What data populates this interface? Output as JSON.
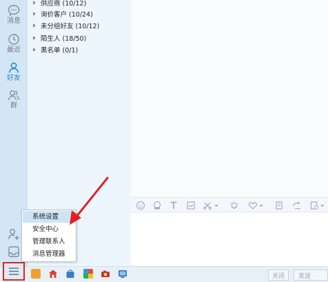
{
  "rail": {
    "items": [
      {
        "label": "消息",
        "icon": "message-icon"
      },
      {
        "label": "最近",
        "icon": "clock-icon"
      },
      {
        "label": "好友",
        "icon": "person-icon"
      },
      {
        "label": "群",
        "icon": "group-icon"
      }
    ],
    "active_index": 2
  },
  "groups": [
    {
      "label": "供应商 (10/12)"
    },
    {
      "label": "询价客户 (10/24)"
    },
    {
      "label": "未分组好友 (10/12)"
    },
    {
      "label": "陌生人 (18/50)"
    },
    {
      "label": "黑名单 (0/1)"
    }
  ],
  "menu": {
    "items": [
      {
        "label": "系统设置",
        "highlight": true
      },
      {
        "label": "安全中心",
        "highlight": false
      },
      {
        "label": "管理联系人",
        "highlight": false
      },
      {
        "label": "消息管理器",
        "highlight": false
      }
    ]
  },
  "footer": {
    "close_label": "关闭",
    "send_label": "发送"
  },
  "colors": {
    "accent": "#2a88d8",
    "annotation_red": "#e02020",
    "rail_bg": "#d4e6f5",
    "panel_bg": "#eef6fd",
    "menu_highlight": "#cde4f7"
  }
}
